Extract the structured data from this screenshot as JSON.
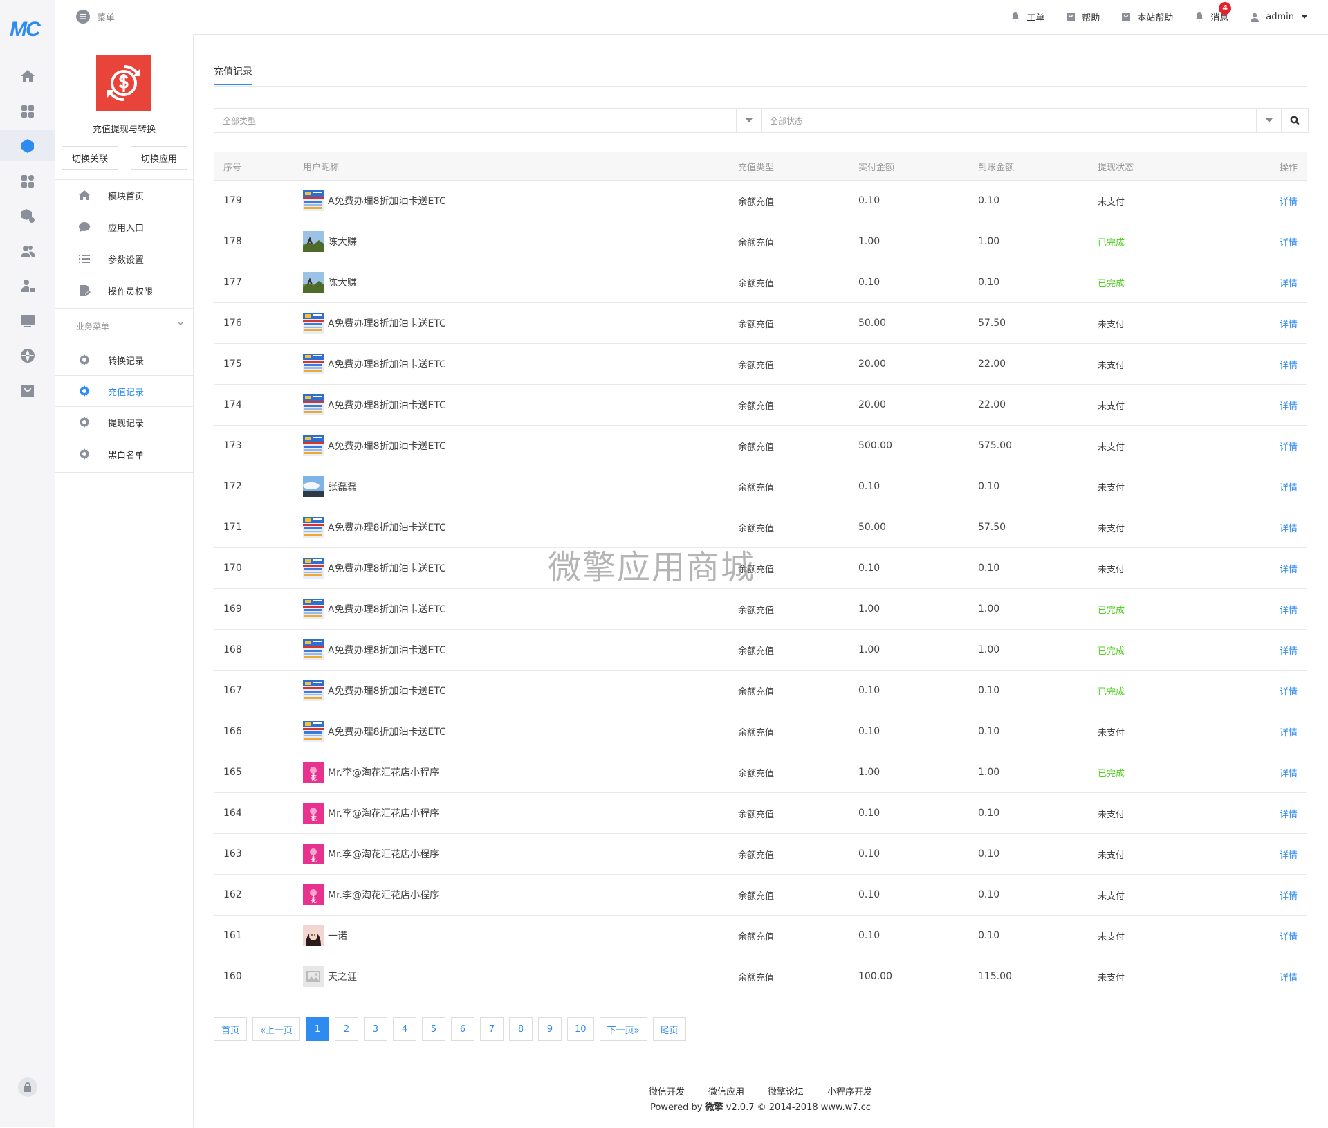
{
  "rail": {
    "logo": "MC",
    "icons": [
      "home-icon",
      "apps-grid-icon",
      "cube-icon",
      "modules-icon",
      "services-icon",
      "users-icon",
      "user-lock-icon",
      "monitor-icon",
      "globe-icon",
      "store-icon"
    ],
    "active_index": 2,
    "bottom_icon": "lock-icon"
  },
  "topbar": {
    "menu_label": "菜单",
    "items": [
      {
        "icon": "bell-icon",
        "label": "工单"
      },
      {
        "icon": "help-icon",
        "label": "帮助"
      },
      {
        "icon": "help-icon",
        "label": "本站帮助"
      },
      {
        "icon": "bell-icon",
        "label": "消息",
        "badge": "4"
      }
    ],
    "user": "admin"
  },
  "sidebar": {
    "app_name": "充值提现与转换",
    "buttons": [
      "切换关联",
      "切换应用"
    ],
    "items": [
      {
        "icon": "home-icon",
        "label": "模块首页"
      },
      {
        "icon": "chat-icon",
        "label": "应用入口"
      },
      {
        "icon": "list-icon",
        "label": "参数设置"
      },
      {
        "icon": "edit-icon",
        "label": "操作员权限"
      }
    ],
    "group_title": "业务菜单",
    "group_items": [
      {
        "icon": "gear-icon",
        "label": "转换记录",
        "active": false
      },
      {
        "icon": "gear-icon",
        "label": "充值记录",
        "active": true
      },
      {
        "icon": "gear-icon",
        "label": "提现记录",
        "active": false
      },
      {
        "icon": "gear-icon",
        "label": "黑白名单",
        "active": false
      }
    ]
  },
  "main": {
    "tab": "充值记录",
    "filter_type_placeholder": "全部类型",
    "filter_status_placeholder": "全部状态",
    "columns": [
      "序号",
      "用户昵称",
      "充值类型",
      "实付金额",
      "到账金额",
      "提现状态",
      "操作"
    ],
    "rows": [
      {
        "id": "179",
        "avatar": "banner",
        "name": "A免费办理8折加油卡送ETC",
        "type": "余额充值",
        "paid": "0.10",
        "received": "0.10",
        "status": "未支付",
        "action": "详情"
      },
      {
        "id": "178",
        "avatar": "landscape",
        "name": "陈大赚",
        "type": "余额充值",
        "paid": "1.00",
        "received": "1.00",
        "status": "已完成",
        "action": "详情"
      },
      {
        "id": "177",
        "avatar": "landscape",
        "name": "陈大赚",
        "type": "余额充值",
        "paid": "0.10",
        "received": "0.10",
        "status": "已完成",
        "action": "详情"
      },
      {
        "id": "176",
        "avatar": "banner",
        "name": "A免费办理8折加油卡送ETC",
        "type": "余额充值",
        "paid": "50.00",
        "received": "57.50",
        "status": "未支付",
        "action": "详情"
      },
      {
        "id": "175",
        "avatar": "banner",
        "name": "A免费办理8折加油卡送ETC",
        "type": "余额充值",
        "paid": "20.00",
        "received": "22.00",
        "status": "未支付",
        "action": "详情"
      },
      {
        "id": "174",
        "avatar": "banner",
        "name": "A免费办理8折加油卡送ETC",
        "type": "余额充值",
        "paid": "20.00",
        "received": "22.00",
        "status": "未支付",
        "action": "详情"
      },
      {
        "id": "173",
        "avatar": "banner",
        "name": "A免费办理8折加油卡送ETC",
        "type": "余额充值",
        "paid": "500.00",
        "received": "575.00",
        "status": "未支付",
        "action": "详情"
      },
      {
        "id": "172",
        "avatar": "sky",
        "name": "张磊磊",
        "type": "余额充值",
        "paid": "0.10",
        "received": "0.10",
        "status": "未支付",
        "action": "详情"
      },
      {
        "id": "171",
        "avatar": "banner",
        "name": "A免费办理8折加油卡送ETC",
        "type": "余额充值",
        "paid": "50.00",
        "received": "57.50",
        "status": "未支付",
        "action": "详情"
      },
      {
        "id": "170",
        "avatar": "banner",
        "name": "A免费办理8折加油卡送ETC",
        "type": "余额充值",
        "paid": "0.10",
        "received": "0.10",
        "status": "未支付",
        "action": "详情"
      },
      {
        "id": "169",
        "avatar": "banner",
        "name": "A免费办理8折加油卡送ETC",
        "type": "余额充值",
        "paid": "1.00",
        "received": "1.00",
        "status": "已完成",
        "action": "详情"
      },
      {
        "id": "168",
        "avatar": "banner",
        "name": "A免费办理8折加油卡送ETC",
        "type": "余额充值",
        "paid": "1.00",
        "received": "1.00",
        "status": "已完成",
        "action": "详情"
      },
      {
        "id": "167",
        "avatar": "banner",
        "name": "A免费办理8折加油卡送ETC",
        "type": "余额充值",
        "paid": "0.10",
        "received": "0.10",
        "status": "已完成",
        "action": "详情"
      },
      {
        "id": "166",
        "avatar": "banner",
        "name": "A免费办理8折加油卡送ETC",
        "type": "余额充值",
        "paid": "0.10",
        "received": "0.10",
        "status": "未支付",
        "action": "详情"
      },
      {
        "id": "165",
        "avatar": "flower",
        "name": "Mr.李@淘花汇花店小程序",
        "type": "余额充值",
        "paid": "1.00",
        "received": "1.00",
        "status": "已完成",
        "action": "详情"
      },
      {
        "id": "164",
        "avatar": "flower",
        "name": "Mr.李@淘花汇花店小程序",
        "type": "余额充值",
        "paid": "0.10",
        "received": "0.10",
        "status": "未支付",
        "action": "详情"
      },
      {
        "id": "163",
        "avatar": "flower",
        "name": "Mr.李@淘花汇花店小程序",
        "type": "余额充值",
        "paid": "0.10",
        "received": "0.10",
        "status": "未支付",
        "action": "详情"
      },
      {
        "id": "162",
        "avatar": "flower",
        "name": "Mr.李@淘花汇花店小程序",
        "type": "余额充值",
        "paid": "0.10",
        "received": "0.10",
        "status": "未支付",
        "action": "详情"
      },
      {
        "id": "161",
        "avatar": "portrait",
        "name": "一诺",
        "type": "余额充值",
        "paid": "0.10",
        "received": "0.10",
        "status": "未支付",
        "action": "详情"
      },
      {
        "id": "160",
        "avatar": "placeholder",
        "name": "天之涯",
        "type": "余额充值",
        "paid": "100.00",
        "received": "115.00",
        "status": "未支付",
        "action": "详情"
      }
    ],
    "status_done": "已完成",
    "pagination": {
      "first": "首页",
      "prev": "«上一页",
      "pages": [
        "1",
        "2",
        "3",
        "4",
        "5",
        "6",
        "7",
        "8",
        "9",
        "10"
      ],
      "current": "1",
      "next": "下一页»",
      "last": "尾页"
    }
  },
  "footer": {
    "links": [
      "微信开发",
      "微信应用",
      "微擎论坛",
      "小程序开发"
    ],
    "powered_prefix": "Powered by ",
    "powered_brand": "微擎",
    "powered_suffix": " v2.0.7 © 2014-2018 www.w7.cc"
  },
  "watermark": "微擎应用商城",
  "colors": {
    "accent": "#2e8bf0",
    "done": "#56d126",
    "app_logo": "#e8443a",
    "badge": "#e6202b"
  }
}
